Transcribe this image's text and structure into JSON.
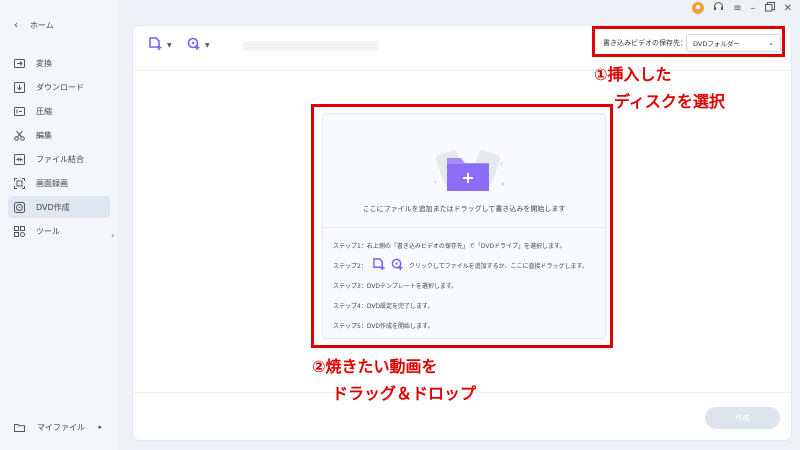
{
  "sidebar": {
    "home_label": "ホーム",
    "items": [
      {
        "label": "変換",
        "icon": "convert-icon"
      },
      {
        "label": "ダウンロード",
        "icon": "download-icon"
      },
      {
        "label": "圧縮",
        "icon": "compress-icon"
      },
      {
        "label": "編集",
        "icon": "scissors-icon"
      },
      {
        "label": "ファイル結合",
        "icon": "merge-icon"
      },
      {
        "label": "画面録画",
        "icon": "screen-record-icon"
      },
      {
        "label": "DVD作成",
        "icon": "disc-icon",
        "active": true
      },
      {
        "label": "ツール",
        "icon": "grid-icon"
      }
    ],
    "my_files_label": "マイファイル"
  },
  "toolbar": {
    "dest_label": "書き込みビデオの保存先：",
    "dest_value": "DVDフォルダー"
  },
  "dropzone": {
    "main_text": "ここにファイルを追加またはドラッグして書き込みを開始します",
    "step1": "ステップ1：右上側の「書き込みビデオの保存先」で「DVDドライブ」を選択します。",
    "step2_prefix": "ステップ2：",
    "step2_suffix": "クリックしてファイルを追加するか、ここに直接ドラッグします。",
    "step3": "ステップ3：DVDテンプレートを選択します。",
    "step4": "ステップ4：DVD設定を完了します。",
    "step5": "ステップ5：DVD作成を開始します。"
  },
  "create_button": "作成",
  "annotations": {
    "a1_line1": "①挿入した",
    "a1_line2": "ディスクを選択",
    "a2_line1": "②焼きたい動画を",
    "a2_line2": "ドラッグ＆ドロップ"
  },
  "colors": {
    "accent": "#7b61ff",
    "annotation": "#e00000",
    "avatar": "#f6a23c"
  }
}
